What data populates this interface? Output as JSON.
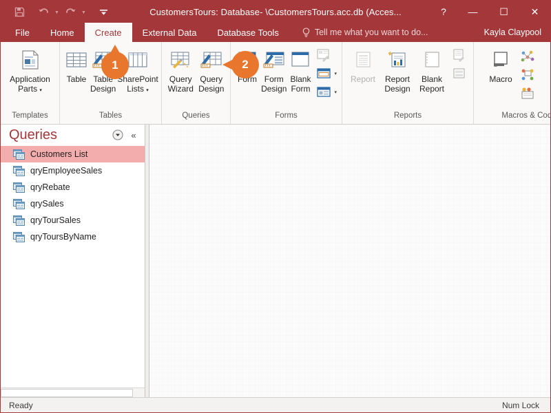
{
  "window": {
    "title": "CustomersTours: Database- \\CustomersTours.acc.db (Acces...",
    "help_label": "?",
    "minimize_label": "—",
    "maximize_label": "☐",
    "close_label": "✕"
  },
  "quick_access": {
    "save_label": "save-icon",
    "undo_label": "undo-icon",
    "redo_label": "redo-icon",
    "customize_label": "customize-icon",
    "caret": "▼"
  },
  "tabs": [
    {
      "label": "File",
      "active": false
    },
    {
      "label": "Home",
      "active": false
    },
    {
      "label": "Create",
      "active": true
    },
    {
      "label": "External Data",
      "active": false
    },
    {
      "label": "Database Tools",
      "active": false
    }
  ],
  "tellme": {
    "placeholder": "Tell me what you want to do...",
    "icon": "lightbulb-icon"
  },
  "account": {
    "user_name": "Kayla Claypool"
  },
  "ribbon": {
    "collapse_label": "∧",
    "groups": [
      {
        "name": "Templates",
        "label": "Templates",
        "buttons": [
          {
            "name": "application-parts",
            "line1": "Application",
            "line2": "Parts",
            "caret": "▾",
            "disabled": false,
            "icon": "application-parts-icon"
          }
        ]
      },
      {
        "name": "Tables",
        "label": "Tables",
        "buttons": [
          {
            "name": "table",
            "line1": "Table",
            "line2": "",
            "caret": "",
            "disabled": false,
            "icon": "table-icon"
          },
          {
            "name": "table-design",
            "line1": "Table",
            "line2": "Design",
            "caret": "",
            "disabled": false,
            "icon": "table-design-icon"
          },
          {
            "name": "sharepoint-lists",
            "line1": "SharePoint",
            "line2": "Lists",
            "caret": "▾",
            "disabled": false,
            "icon": "sharepoint-lists-icon"
          }
        ]
      },
      {
        "name": "Queries",
        "label": "Queries",
        "buttons": [
          {
            "name": "query-wizard",
            "line1": "Query",
            "line2": "Wizard",
            "caret": "",
            "disabled": false,
            "icon": "query-wizard-icon"
          },
          {
            "name": "query-design",
            "line1": "Query",
            "line2": "Design",
            "caret": "",
            "disabled": false,
            "icon": "query-design-icon"
          }
        ]
      },
      {
        "name": "Forms",
        "label": "Forms",
        "buttons": [
          {
            "name": "form",
            "line1": "Form",
            "line2": "",
            "caret": "",
            "disabled": false,
            "icon": "form-icon"
          },
          {
            "name": "form-design",
            "line1": "Form",
            "line2": "Design",
            "caret": "",
            "disabled": false,
            "icon": "form-design-icon"
          },
          {
            "name": "blank-form",
            "line1": "Blank",
            "line2": "Form",
            "caret": "",
            "disabled": false,
            "icon": "blank-form-icon"
          }
        ],
        "small_items": [
          {
            "name": "form-wizard",
            "icon": "form-wizard-icon",
            "caret": ""
          },
          {
            "name": "navigation",
            "icon": "navigation-icon",
            "caret": "▾"
          },
          {
            "name": "more-forms",
            "icon": "more-forms-icon",
            "caret": "▾"
          }
        ]
      },
      {
        "name": "Reports",
        "label": "Reports",
        "buttons": [
          {
            "name": "report",
            "line1": "Report",
            "line2": "",
            "caret": "",
            "disabled": true,
            "icon": "report-icon"
          },
          {
            "name": "report-design",
            "line1": "Report",
            "line2": "Design",
            "caret": "",
            "disabled": false,
            "icon": "report-design-icon"
          },
          {
            "name": "blank-report",
            "line1": "Blank",
            "line2": "Report",
            "caret": "",
            "disabled": false,
            "icon": "blank-report-icon"
          }
        ],
        "small_items": [
          {
            "name": "report-wizard",
            "icon": "report-wizard-icon",
            "caret": ""
          },
          {
            "name": "labels",
            "icon": "labels-icon",
            "caret": ""
          }
        ]
      },
      {
        "name": "Macros & Code",
        "label": "Macros & Code",
        "buttons": [
          {
            "name": "macro",
            "line1": "Macro",
            "line2": "",
            "caret": "",
            "disabled": false,
            "icon": "macro-icon"
          }
        ],
        "code_icons": [
          {
            "name": "module",
            "icon": "module-icon"
          },
          {
            "name": "class-module",
            "icon": "class-module-icon"
          },
          {
            "name": "visual-basic",
            "icon": "visual-basic-icon"
          }
        ]
      }
    ]
  },
  "callouts": [
    {
      "number": "1",
      "direction": "up",
      "target": "table-design"
    },
    {
      "number": "2",
      "direction": "left",
      "target": "query-design"
    }
  ],
  "nav_pane": {
    "title": "Queries",
    "menu_label": "▾",
    "collapse_label": "«",
    "items": [
      {
        "label": "Customers List",
        "selected": true
      },
      {
        "label": "qryEmployeeSales",
        "selected": false
      },
      {
        "label": "qryRebate",
        "selected": false
      },
      {
        "label": "qrySales",
        "selected": false
      },
      {
        "label": "qryTourSales",
        "selected": false
      },
      {
        "label": "qryToursByName",
        "selected": false
      }
    ]
  },
  "status_bar": {
    "left": "Ready",
    "right": "Num Lock"
  },
  "colors": {
    "accent": "#a4373a",
    "selection": "#f4adad",
    "badge": "#e8762c",
    "ribbon_bg": "#faf9f8"
  }
}
